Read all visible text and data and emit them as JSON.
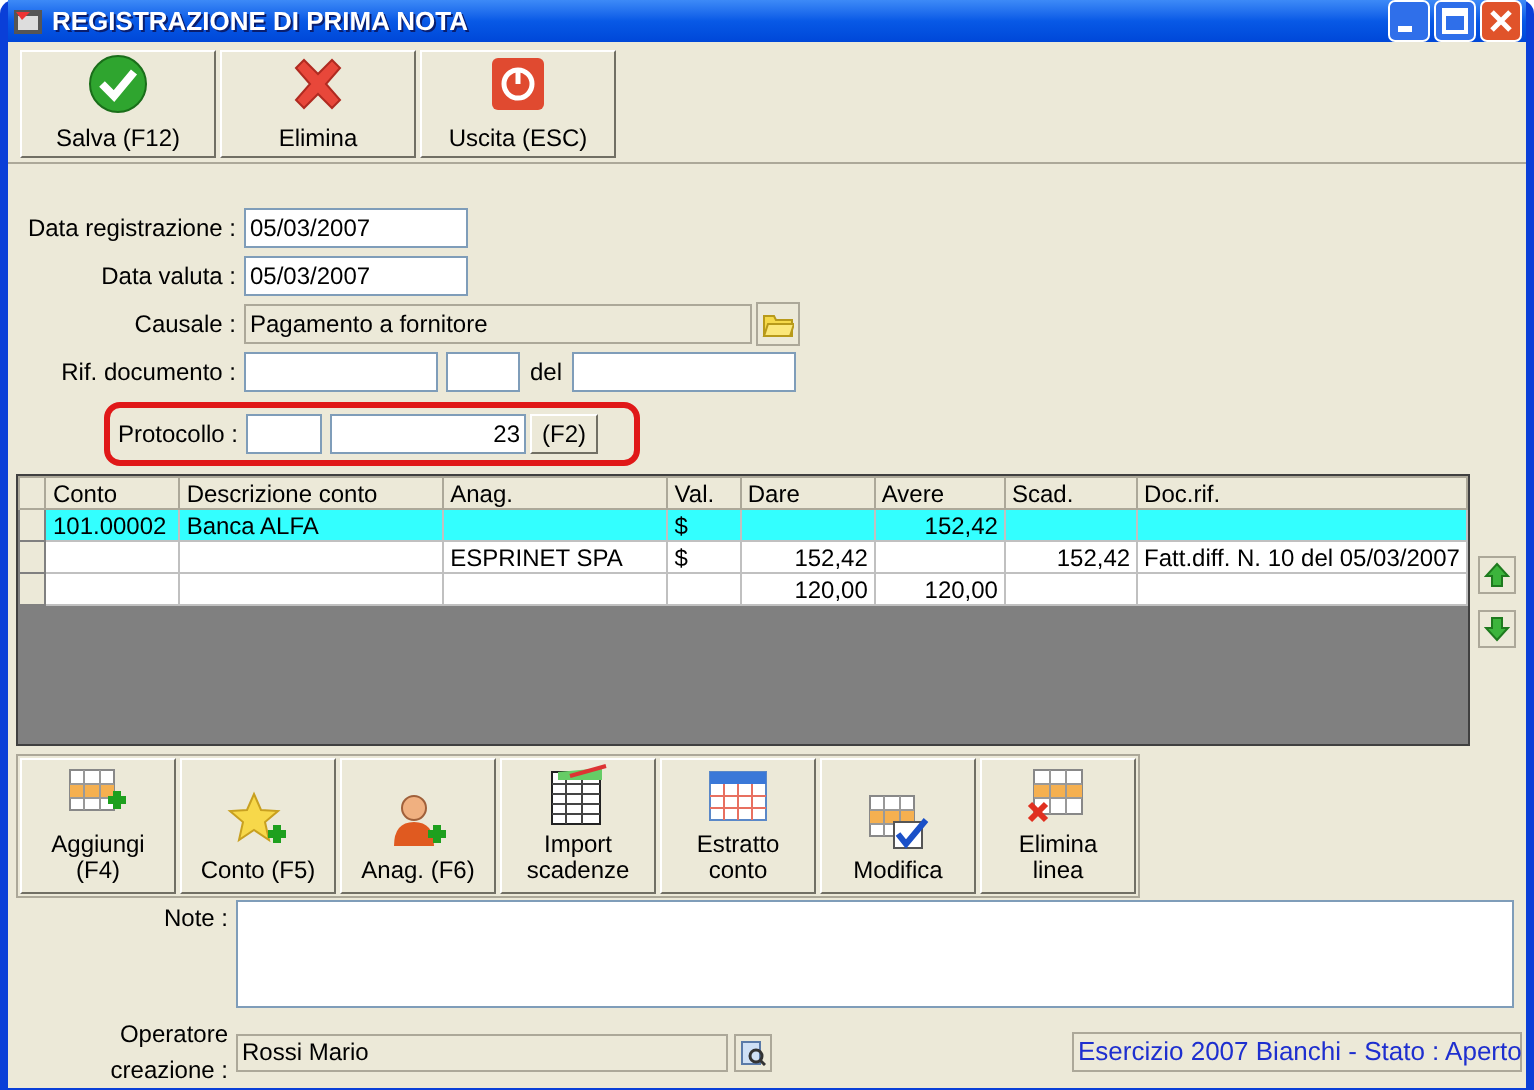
{
  "window": {
    "title": "REGISTRAZIONE DI PRIMA NOTA"
  },
  "toolbar": [
    {
      "label": "Salva (F12)"
    },
    {
      "label": "Elimina"
    },
    {
      "label": "Uscita (ESC)"
    }
  ],
  "form": {
    "data_registrazione": {
      "label": "Data registrazione :",
      "value": "05/03/2007"
    },
    "data_valuta": {
      "label": "Data valuta :",
      "value": "05/03/2007"
    },
    "causale": {
      "label": "Causale :",
      "value": "Pagamento a fornitore",
      "disabled": true
    },
    "rif_documento": {
      "label": "Rif. documento :",
      "del_label": "del"
    },
    "protocollo": {
      "label": "Protocollo :",
      "value": "23",
      "button": "(F2)",
      "highlighted": true
    }
  },
  "table": {
    "columns": [
      "Conto",
      "Descrizione conto",
      "Anag.",
      "Val.",
      "Dare",
      "Avere",
      "Scad.",
      "Doc.rif."
    ],
    "rows": [
      {
        "selected": true,
        "cells": [
          "101.00002",
          "Banca ALFA",
          "",
          "$",
          "",
          "152,42",
          "",
          ""
        ]
      },
      {
        "selected": false,
        "cells": [
          "",
          "",
          "ESPRINET SPA",
          "$",
          "152,42",
          "",
          "152,42",
          "Fatt.diff. N. 10 del 05/03/2007"
        ]
      },
      {
        "selected": false,
        "cells": [
          "",
          "",
          "",
          "",
          "120,00",
          "120,00",
          "",
          ""
        ]
      }
    ]
  },
  "actions": [
    {
      "label": "Aggiungi (F4)"
    },
    {
      "label": "Conto (F5)"
    },
    {
      "label": "Anag. (F6)"
    },
    {
      "label": "Import scadenze"
    },
    {
      "label": "Estratto conto"
    },
    {
      "label": "Modifica"
    },
    {
      "label": "Elimina linea"
    }
  ],
  "note": {
    "label": "Note :"
  },
  "operatore": {
    "label": "Operatore creazione :",
    "value": "Rossi Mario",
    "disabled": true
  },
  "status_bar": {
    "text": "Esercizio 2007 Bianchi - Stato : Aperto"
  }
}
